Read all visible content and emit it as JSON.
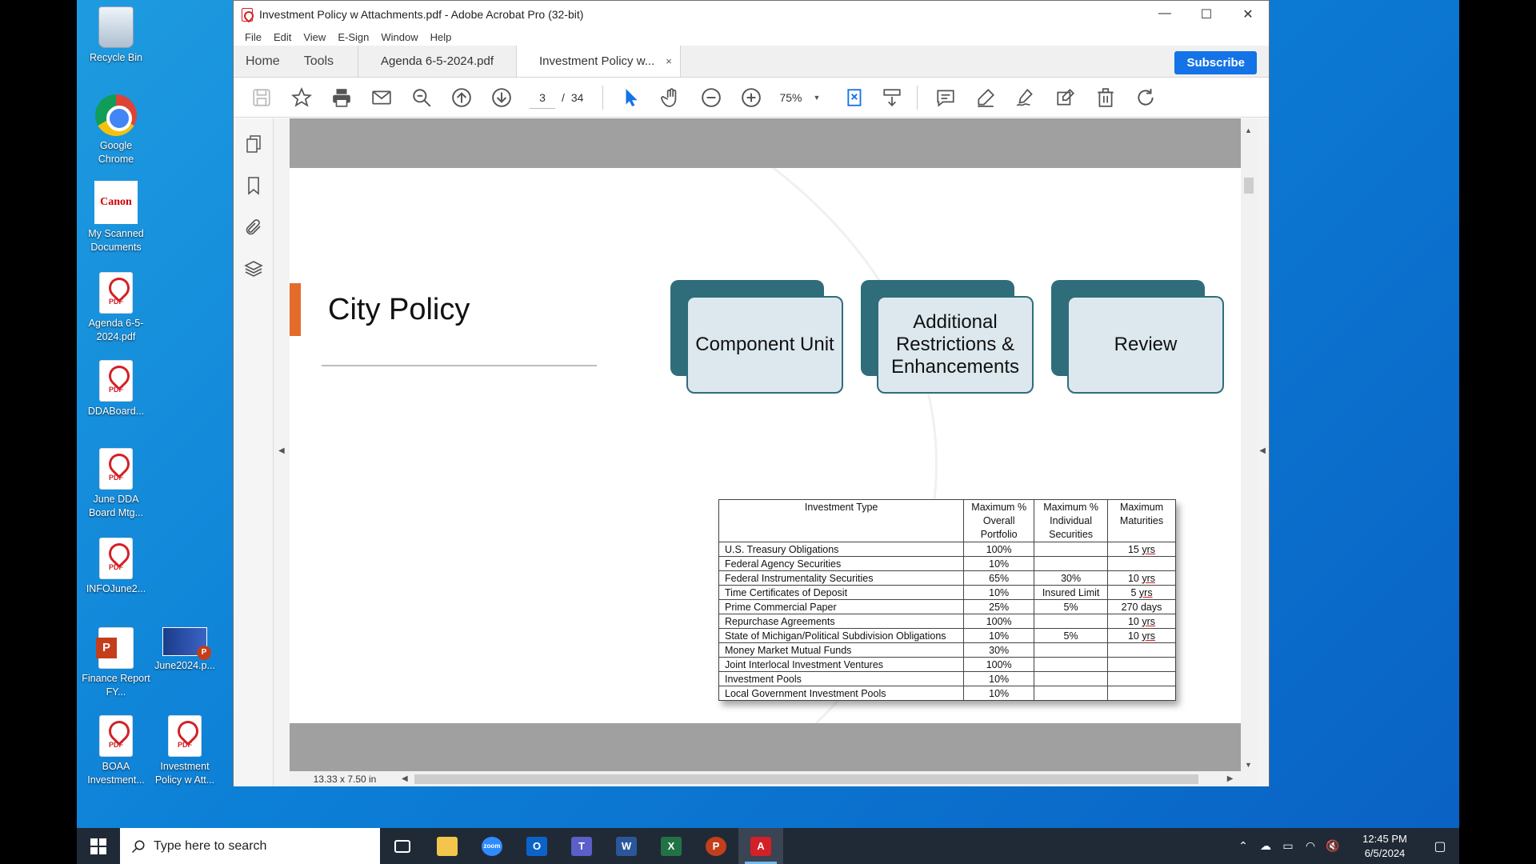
{
  "desktop": {
    "icons": [
      {
        "id": "recycle-bin",
        "label": "Recycle Bin"
      },
      {
        "id": "chrome",
        "label": "Google Chrome"
      },
      {
        "id": "canon",
        "label": "My Scanned Documents",
        "logo_text": "Canon"
      },
      {
        "id": "agenda-pdf",
        "label": "Agenda 6-5-2024.pdf"
      },
      {
        "id": "ddaboard",
        "label": "DDABoard..."
      },
      {
        "id": "june-dda",
        "label": "June DDA Board Mtg..."
      },
      {
        "id": "infojune",
        "label": "INFOJune2..."
      },
      {
        "id": "finance-report",
        "label": "Finance Report FY..."
      },
      {
        "id": "june2024",
        "label": "June2024.p..."
      },
      {
        "id": "boaa",
        "label": "BOAA Investment..."
      },
      {
        "id": "investment-policy",
        "label": "Investment Policy w Att..."
      }
    ],
    "pdf_badge": "PDF"
  },
  "window": {
    "title": "Investment Policy w Attachments.pdf - Adobe Acrobat Pro (32-bit)",
    "controls": {
      "minimize": "—",
      "maximize": "☐",
      "close": "✕"
    },
    "menu": [
      "File",
      "Edit",
      "View",
      "E-Sign",
      "Window",
      "Help"
    ],
    "tabs": {
      "home": "Home",
      "tools": "Tools",
      "doc1": "Agenda 6-5-2024.pdf",
      "doc2": "Investment Policy w...",
      "close": "×"
    },
    "subscribe": "Subscribe",
    "toolbar": {
      "current_page": "3",
      "page_sep": "/",
      "total_pages": "34",
      "zoom": "75%"
    },
    "status": {
      "page_size": "13.33 x 7.50 in"
    }
  },
  "slide": {
    "title": "City Policy",
    "boxes": [
      "Component Unit",
      "Additional Restrictions & Enhancements",
      "Review"
    ],
    "table": {
      "headers": [
        "Investment Type",
        "Maximum % Overall Portfolio",
        "Maximum % Individual Securities",
        "Maximum Maturities"
      ],
      "rows": [
        [
          "U.S. Treasury Obligations",
          "100%",
          "",
          "15 yrs"
        ],
        [
          "Federal Agency Securities",
          "10%",
          "",
          ""
        ],
        [
          "Federal Instrumentality Securities",
          "65%",
          "30%",
          "10 yrs"
        ],
        [
          "Time Certificates of Deposit",
          "10%",
          "Insured Limit",
          "5 yrs"
        ],
        [
          "Prime Commercial Paper",
          "25%",
          "5%",
          "270 days"
        ],
        [
          "Repurchase Agreements",
          "100%",
          "",
          "10 yrs"
        ],
        [
          "State of Michigan/Political Subdivision Obligations",
          "10%",
          "5%",
          "10 yrs"
        ],
        [
          "Money Market Mutual Funds",
          "30%",
          "",
          ""
        ],
        [
          "Joint Interlocal Investment Ventures",
          "100%",
          "",
          ""
        ],
        [
          "Investment Pools",
          "10%",
          "",
          ""
        ],
        [
          "Local Government Investment Pools",
          "10%",
          "",
          ""
        ]
      ]
    }
  },
  "taskbar": {
    "search_placeholder": "Type here to search",
    "time": "12:45 PM",
    "date": "6/5/2024",
    "apps": [
      "task-view",
      "file-explorer",
      "zoom",
      "outlook",
      "teams",
      "word",
      "excel",
      "powerpoint",
      "acrobat"
    ]
  },
  "colors": {
    "accent": "#1473e6",
    "slide_teal": "#2f6d7b",
    "slide_orange": "#e36c2b"
  }
}
